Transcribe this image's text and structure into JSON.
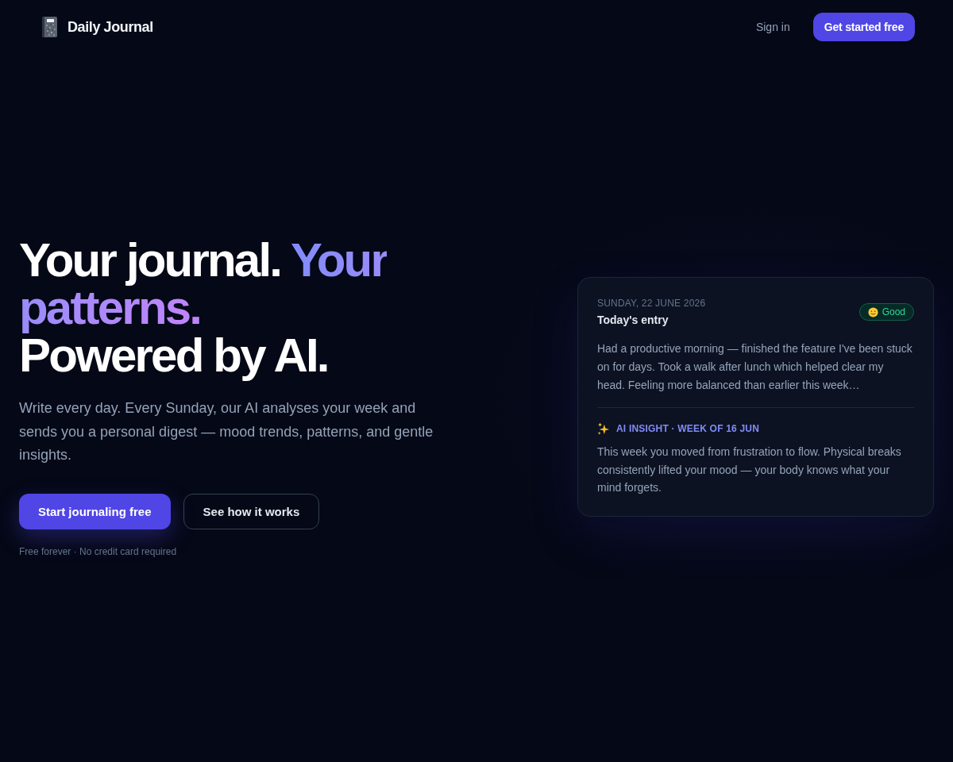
{
  "header": {
    "brand": "Daily Journal",
    "sign_in": "Sign in",
    "cta": "Get started free"
  },
  "hero": {
    "headline": [
      {
        "text": "Your journal.",
        "kind": "plain"
      },
      {
        "text": "Your patterns.",
        "kind": "gradient"
      },
      {
        "text": "Powered by AI.",
        "kind": "line"
      }
    ],
    "subtitle": "Write every day. Every Sunday, our AI analyses your week and sends you a personal digest — mood trends, patterns, and gentle insights.",
    "buttons": [
      {
        "label": "Start journaling free",
        "kind": "primary"
      },
      {
        "label": "See how it works",
        "kind": "secondary"
      }
    ],
    "note": "Free forever · No credit card required"
  },
  "entry_card": {
    "date": "SUNDAY, 22 JUNE 2026",
    "title": "Today's entry",
    "mood": "Good",
    "text": "Had a productive morning — finished the feature I've been stuck on for days. Took a walk after lunch which helped clear my head. Feeling more balanced than earlier this week…",
    "insight": {
      "label": "AI INSIGHT · WEEK OF 16 JUN",
      "text": "This week you moved from frustration to flow. Physical breaks consistently lifted your mood — your body knows what your mind forgets."
    }
  }
}
